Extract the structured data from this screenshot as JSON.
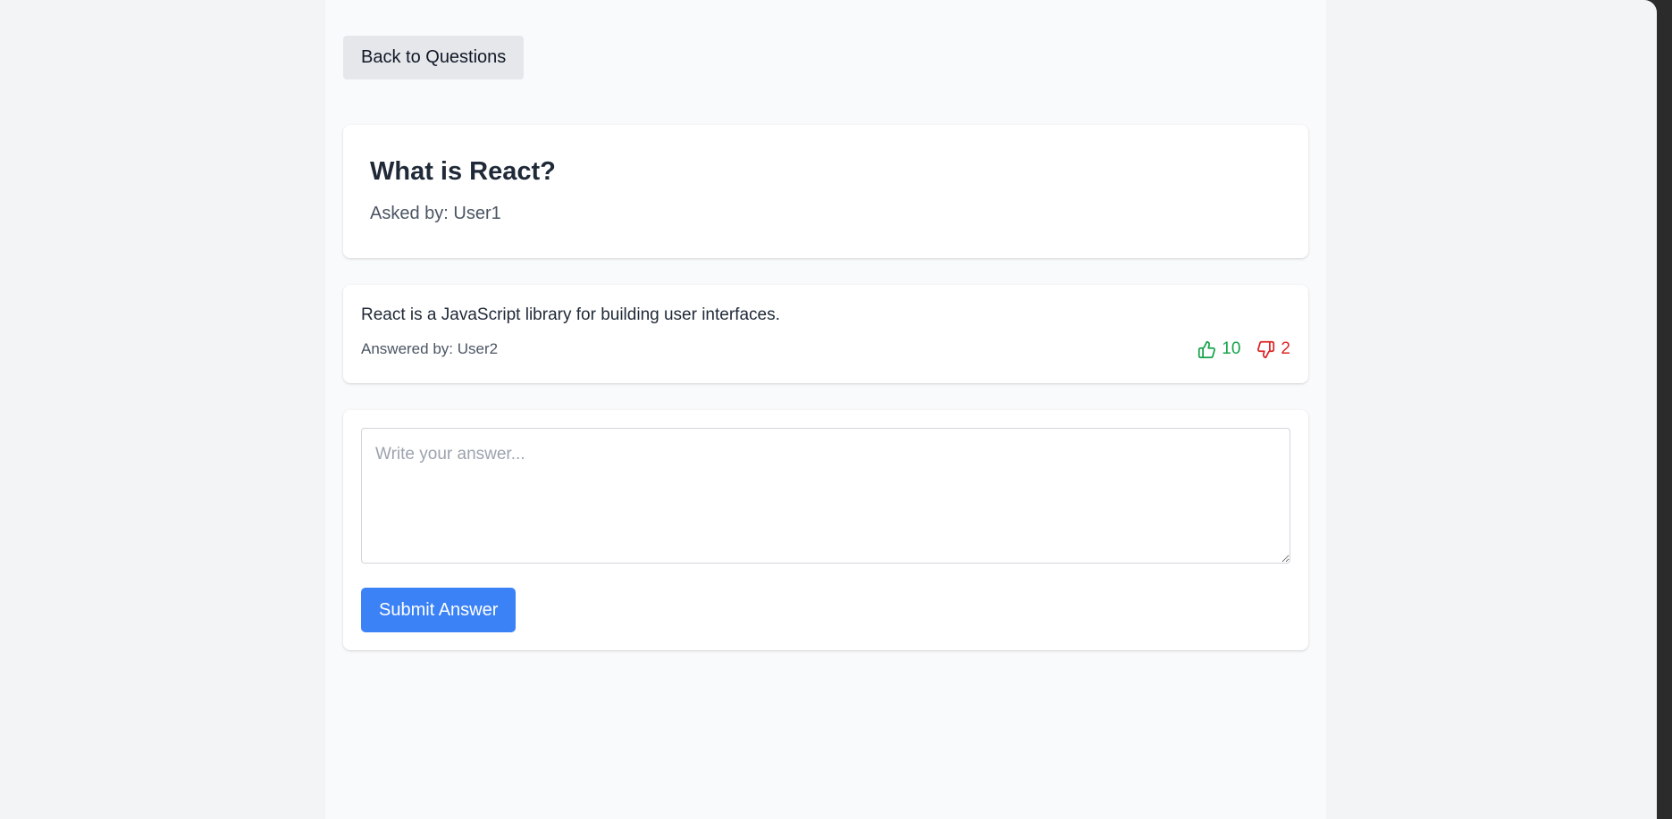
{
  "nav": {
    "back_label": "Back to Questions"
  },
  "question": {
    "title": "What is React?",
    "asked_by": "Asked by: User1"
  },
  "answers": [
    {
      "text": "React is a JavaScript library for building user interfaces.",
      "answered_by": "Answered by: User2",
      "upvotes": "10",
      "downvotes": "2"
    }
  ],
  "form": {
    "placeholder": "Write your answer...",
    "value": "",
    "submit_label": "Submit Answer"
  },
  "icons": {
    "upvote": "thumbs-up-icon",
    "downvote": "thumbs-down-icon"
  },
  "colors": {
    "upvote": "#16a34a",
    "downvote": "#dc2626",
    "primary": "#3b82f6"
  }
}
